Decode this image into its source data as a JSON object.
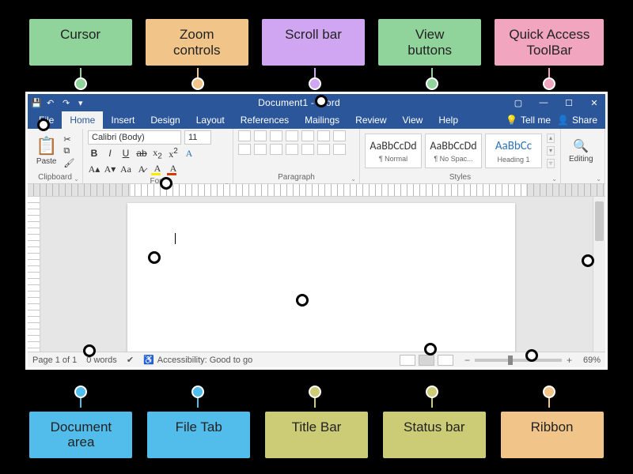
{
  "callouts": {
    "top": [
      "Cursor",
      "Zoom\ncontrols",
      "Scroll bar",
      "View\nbuttons",
      "Quick Access\nToolBar"
    ],
    "bottom": [
      "Document\narea",
      "File Tab",
      "Title Bar",
      "Status bar",
      "Ribbon"
    ]
  },
  "titlebar": {
    "title": "Document1  -  Word"
  },
  "tabs": {
    "file": "File",
    "home": "Home",
    "insert": "Insert",
    "design": "Design",
    "layout": "Layout",
    "references": "References",
    "mailings": "Mailings",
    "review": "Review",
    "view": "View",
    "help": "Help",
    "tellme": "Tell me",
    "share": "Share"
  },
  "ribbon": {
    "clipboard": {
      "paste": "Paste",
      "label": "Clipboard"
    },
    "font": {
      "name": "Calibri (Body)",
      "size": "11",
      "label": "Font"
    },
    "paragraph": {
      "label": "Paragraph"
    },
    "styles": {
      "label": "Styles",
      "cards": [
        {
          "sample": "AaBbCcDd",
          "name": "¶ Normal"
        },
        {
          "sample": "AaBbCcDd",
          "name": "¶ No Spac..."
        },
        {
          "sample": "AaBbCc",
          "name": "Heading 1"
        }
      ]
    },
    "editing": {
      "label": "Editing"
    }
  },
  "status": {
    "page": "Page 1 of 1",
    "words": "0 words",
    "accessibility": "Accessibility: Good to go",
    "zoom": "69%"
  }
}
